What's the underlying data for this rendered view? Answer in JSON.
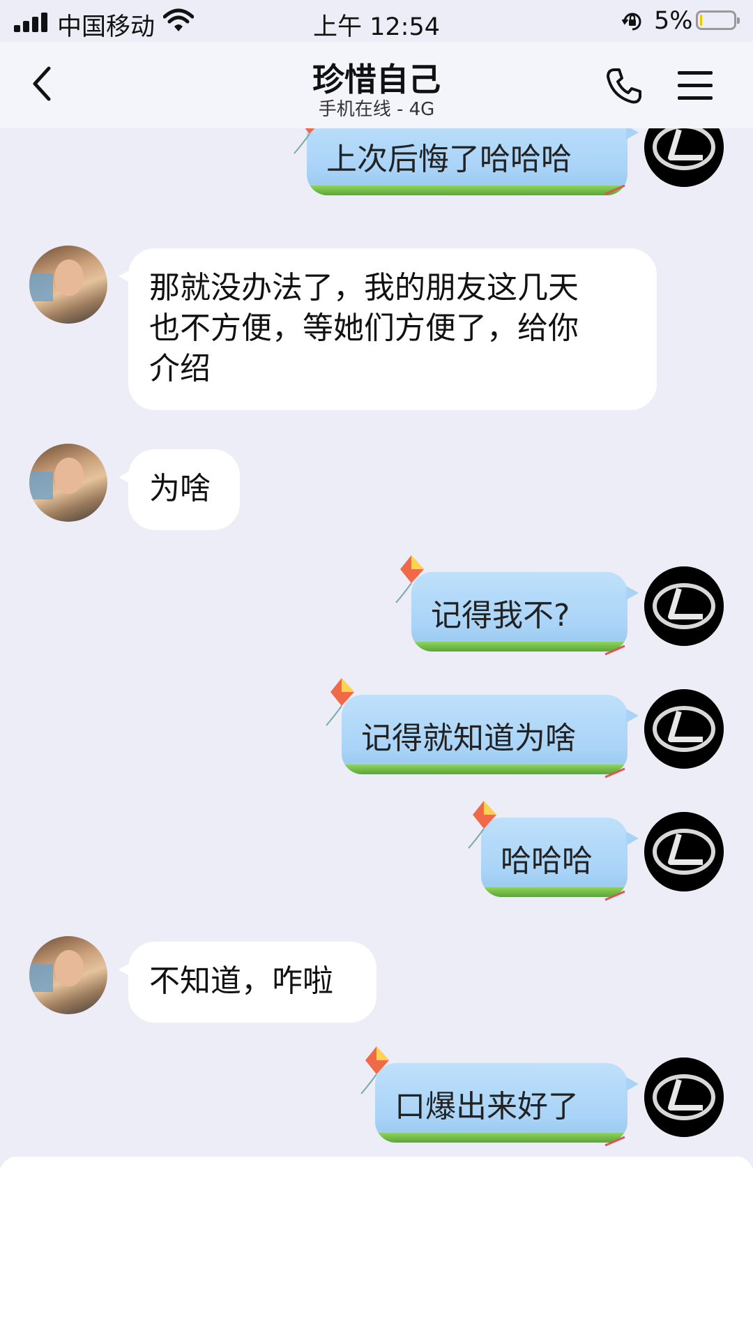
{
  "status_bar": {
    "carrier": "中国移动",
    "time": "上午 12:54",
    "battery_percent_text": "5%",
    "battery_level": 0.05,
    "icons": [
      "signal-icon",
      "wifi-icon",
      "rotation-lock-icon",
      "battery-icon"
    ]
  },
  "header": {
    "title": "珍惜自己",
    "subtitle": "手机在线 - 4G",
    "icons": [
      "back-arrow-icon",
      "phone-icon",
      "menu-icon"
    ]
  },
  "messages": [
    {
      "side": "right",
      "text": "上次后悔了哈哈哈"
    },
    {
      "side": "left",
      "lines": [
        "那就没办法了，我的朋友这几天",
        "也不方便，等她们方便了，给你",
        "介绍"
      ]
    },
    {
      "side": "left",
      "text": "为啥"
    },
    {
      "side": "right",
      "text": "记得我不?"
    },
    {
      "side": "right",
      "text": "记得就知道为啥"
    },
    {
      "side": "right",
      "text": "哈哈哈"
    },
    {
      "side": "left",
      "text": "不知道，咋啦"
    },
    {
      "side": "right",
      "text": "口爆出来好了"
    }
  ],
  "colors": {
    "background": "#ecedf7",
    "incoming_bubble": "#ffffff",
    "outgoing_bubble": "#a8d3f7",
    "grass": "#6cbc45",
    "battery_fill": "#f2c200"
  }
}
